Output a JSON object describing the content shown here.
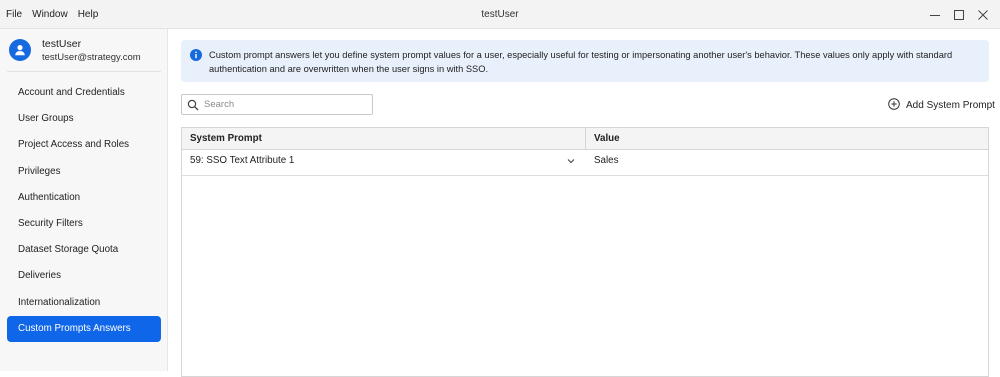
{
  "titlebar": {
    "menu": [
      "File",
      "Window",
      "Help"
    ],
    "title": "testUser"
  },
  "sidebar": {
    "user": {
      "name": "testUser",
      "email": "testUser@strategy.com",
      "icon": "user-avatar-icon"
    },
    "items": [
      {
        "label": "Account and Credentials"
      },
      {
        "label": "User Groups"
      },
      {
        "label": "Project Access and Roles"
      },
      {
        "label": "Privileges"
      },
      {
        "label": "Authentication"
      },
      {
        "label": "Security Filters"
      },
      {
        "label": "Dataset Storage Quota"
      },
      {
        "label": "Deliveries"
      },
      {
        "label": "Internationalization"
      },
      {
        "label": "Custom Prompts Answers",
        "active": true
      }
    ]
  },
  "main": {
    "info": "Custom prompt answers let you define system prompt values for a user, especially useful for testing or impersonating another user's behavior. These values only apply with standard authentication and are overwritten when the user signs in with SSO.",
    "search": {
      "placeholder": "Search",
      "value": ""
    },
    "add_button": "Add System Prompt",
    "table": {
      "headers": [
        "System Prompt",
        "Value"
      ],
      "rows": [
        {
          "prompt": "59: SSO Text Attribute 1",
          "value": "Sales"
        }
      ]
    }
  },
  "colors": {
    "accent": "#0f66e9",
    "banner_bg": "#e8f0fb",
    "sidebar_bg": "#f7f7f7"
  }
}
